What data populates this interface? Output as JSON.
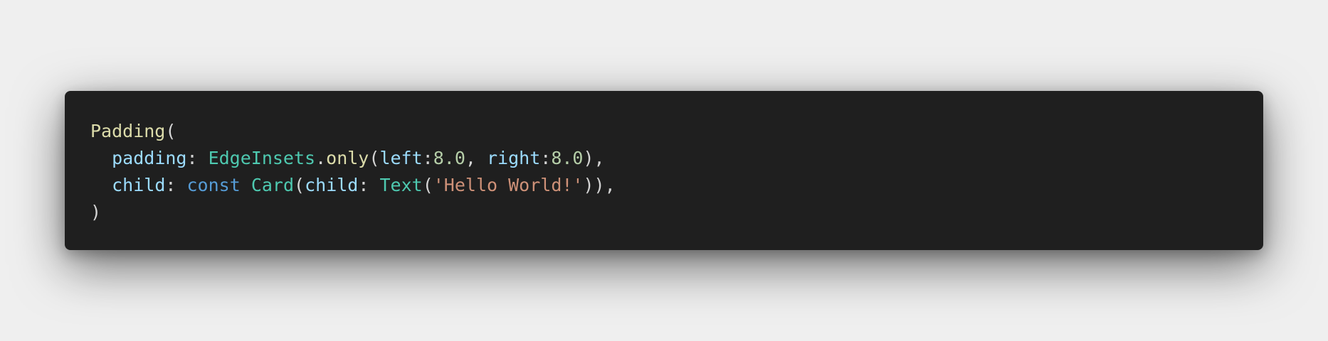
{
  "colors": {
    "background": "#efefef",
    "code_background": "#1f1f1f",
    "default_text": "#d4d4d4",
    "function": "#dcdcaa",
    "property": "#9cdcfe",
    "type": "#4ec9b0",
    "number": "#b5cea8",
    "keyword": "#569cd6",
    "string": "#ce9178"
  },
  "code": {
    "line1": {
      "fn": "Padding",
      "open": "("
    },
    "line2": {
      "indent": "  ",
      "prop": "padding",
      "colon": ": ",
      "type": "EdgeInsets",
      "dot": ".",
      "method": "only",
      "open": "(",
      "arg1_name": "left",
      "arg1_colon": ":",
      "arg1_value": "8.0",
      "comma": ", ",
      "arg2_name": "right",
      "arg2_colon": ":",
      "arg2_value": "8.0",
      "close": "),"
    },
    "line3": {
      "indent": "  ",
      "prop": "child",
      "colon": ": ",
      "keyword": "const",
      "space1": " ",
      "type1": "Card",
      "open1": "(",
      "inner_prop": "child",
      "inner_colon": ": ",
      "type2": "Text",
      "open2": "(",
      "string": "'Hello World!'",
      "close": ")),"
    },
    "line4": {
      "close": ")"
    }
  }
}
